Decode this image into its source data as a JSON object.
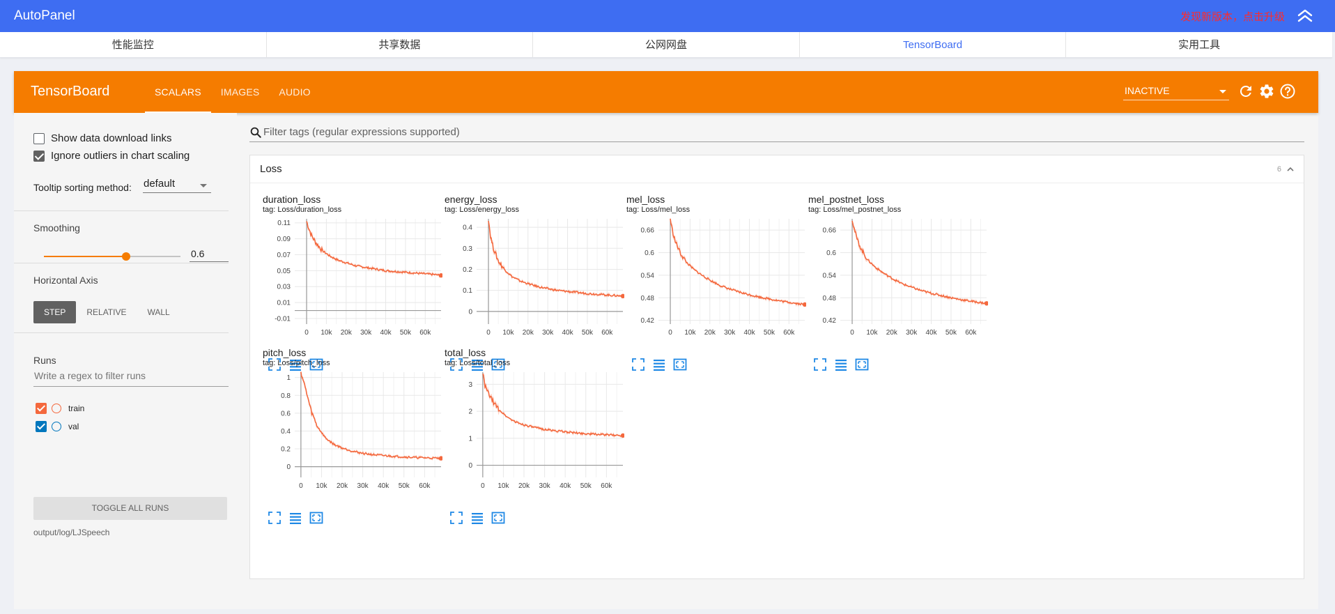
{
  "app": {
    "title": "AutoPanel",
    "upgrade_notice": "发现新版本，点击升级",
    "collapse_icon": "double-chevron-up-icon"
  },
  "tabs": [
    {
      "label": "性能监控",
      "active": false
    },
    {
      "label": "共享数据",
      "active": false
    },
    {
      "label": "公网网盘",
      "active": false
    },
    {
      "label": "TensorBoard",
      "active": true
    },
    {
      "label": "实用工具",
      "active": false
    }
  ],
  "tensorboard": {
    "brand": "TensorBoard",
    "nav": [
      {
        "label": "SCALARS",
        "active": true
      },
      {
        "label": "IMAGES",
        "active": false
      },
      {
        "label": "AUDIO",
        "active": false
      }
    ],
    "status_select": "INACTIVE",
    "icons": [
      "refresh-icon",
      "settings-icon",
      "help-icon"
    ],
    "accent_color": "#f57c00"
  },
  "sidebar": {
    "show_download_label": "Show data download links",
    "show_download_checked": false,
    "ignore_outliers_label": "Ignore outliers in chart scaling",
    "ignore_outliers_checked": true,
    "tooltip_sort_label": "Tooltip sorting method:",
    "tooltip_sort_value": "default",
    "smoothing_label": "Smoothing",
    "smoothing_value": "0.6",
    "smoothing_fraction": 0.6,
    "horizontal_axis_label": "Horizontal Axis",
    "axis_options": [
      {
        "label": "STEP",
        "active": true
      },
      {
        "label": "RELATIVE",
        "active": false
      },
      {
        "label": "WALL",
        "active": false
      }
    ],
    "runs_label": "Runs",
    "runs_filter_placeholder": "Write a regex to filter runs",
    "runs": [
      {
        "name": "train",
        "color": "#f4683d",
        "checked": true
      },
      {
        "name": "val",
        "color": "#0277bd",
        "checked": true
      }
    ],
    "toggle_all_label": "TOGGLE ALL RUNS",
    "log_dir": "output/log/LJSpeech"
  },
  "main": {
    "filter_placeholder": "Filter tags (regular expressions supported)",
    "card_title": "Loss",
    "card_count": "6"
  },
  "chart_data": [
    {
      "type": "line",
      "title": "duration_loss",
      "tag": "tag: Loss/duration_loss",
      "xticks": [
        "0",
        "10k",
        "20k",
        "30k",
        "40k",
        "50k",
        "60k"
      ],
      "yticks": [
        "0.11",
        "0.09",
        "0.07",
        "0.05",
        "0.03",
        "0.01",
        "-0.01"
      ],
      "ylim": [
        -0.017,
        0.115
      ],
      "xlim": [
        -6000,
        68000
      ],
      "series": [
        {
          "color": "#f4683d",
          "x": [
            0,
            1000,
            2500,
            5000,
            8000,
            12000,
            16000,
            20000,
            25000,
            30000,
            35000,
            40000,
            45000,
            50000,
            55000,
            60000,
            65000,
            68000
          ],
          "y": [
            0.112,
            0.104,
            0.094,
            0.084,
            0.075,
            0.068,
            0.063,
            0.06,
            0.056,
            0.054,
            0.052,
            0.05,
            0.049,
            0.048,
            0.047,
            0.046,
            0.045,
            0.044
          ]
        }
      ]
    },
    {
      "type": "line",
      "title": "energy_loss",
      "tag": "tag: Loss/energy_loss",
      "xticks": [
        "0",
        "10k",
        "20k",
        "30k",
        "40k",
        "50k",
        "60k"
      ],
      "yticks": [
        "0.4",
        "0.3",
        "0.2",
        "0.1",
        "0"
      ],
      "ylim": [
        -0.06,
        0.44
      ],
      "xlim": [
        -6000,
        68000
      ],
      "series": [
        {
          "color": "#f4683d",
          "x": [
            0,
            1000,
            2500,
            5000,
            8000,
            12000,
            16000,
            20000,
            25000,
            30000,
            35000,
            40000,
            45000,
            50000,
            55000,
            60000,
            65000,
            68000
          ],
          "y": [
            0.44,
            0.36,
            0.3,
            0.24,
            0.2,
            0.165,
            0.145,
            0.132,
            0.118,
            0.108,
            0.1,
            0.095,
            0.09,
            0.085,
            0.082,
            0.078,
            0.075,
            0.073
          ]
        }
      ]
    },
    {
      "type": "line",
      "title": "mel_loss",
      "tag": "tag: Loss/mel_loss",
      "xticks": [
        "0",
        "10k",
        "20k",
        "30k",
        "40k",
        "50k",
        "60k"
      ],
      "yticks": [
        "0.66",
        "0.6",
        "0.54",
        "0.48",
        "0.42"
      ],
      "ylim": [
        0.41,
        0.69
      ],
      "xlim": [
        -6000,
        68000
      ],
      "series": [
        {
          "color": "#f4683d",
          "x": [
            0,
            1000,
            2500,
            5000,
            8000,
            12000,
            16000,
            20000,
            25000,
            30000,
            35000,
            40000,
            45000,
            50000,
            55000,
            60000,
            65000,
            68000
          ],
          "y": [
            0.69,
            0.66,
            0.63,
            0.6,
            0.575,
            0.555,
            0.54,
            0.527,
            0.513,
            0.503,
            0.495,
            0.488,
            0.482,
            0.477,
            0.472,
            0.468,
            0.464,
            0.462
          ]
        }
      ]
    },
    {
      "type": "line",
      "title": "mel_postnet_loss",
      "tag": "tag: Loss/mel_postnet_loss",
      "xticks": [
        "0",
        "10k",
        "20k",
        "30k",
        "40k",
        "50k",
        "60k"
      ],
      "yticks": [
        "0.66",
        "0.6",
        "0.54",
        "0.48",
        "0.42"
      ],
      "ylim": [
        0.41,
        0.69
      ],
      "xlim": [
        -6000,
        68000
      ],
      "series": [
        {
          "color": "#f4683d",
          "x": [
            0,
            1000,
            2500,
            5000,
            8000,
            12000,
            16000,
            20000,
            25000,
            30000,
            35000,
            40000,
            45000,
            50000,
            55000,
            60000,
            65000,
            68000
          ],
          "y": [
            0.69,
            0.665,
            0.635,
            0.605,
            0.58,
            0.56,
            0.545,
            0.532,
            0.518,
            0.508,
            0.499,
            0.492,
            0.486,
            0.48,
            0.475,
            0.471,
            0.467,
            0.465
          ]
        }
      ]
    },
    {
      "type": "line",
      "title": "pitch_loss",
      "tag": "tag: Loss/pitch_loss",
      "xticks": [
        "0",
        "10k",
        "20k",
        "30k",
        "40k",
        "50k",
        "60k"
      ],
      "yticks": [
        "1",
        "0.8",
        "0.6",
        "0.4",
        "0.2",
        "0"
      ],
      "ylim": [
        -0.12,
        1.06
      ],
      "xlim": [
        -3000,
        68000
      ],
      "series": [
        {
          "color": "#f4683d",
          "x": [
            0,
            1000,
            2500,
            5000,
            8000,
            12000,
            16000,
            20000,
            25000,
            30000,
            35000,
            40000,
            45000,
            50000,
            55000,
            60000,
            65000,
            68000
          ],
          "y": [
            1.06,
            0.98,
            0.85,
            0.62,
            0.45,
            0.32,
            0.25,
            0.21,
            0.175,
            0.15,
            0.135,
            0.125,
            0.117,
            0.11,
            0.104,
            0.1,
            0.096,
            0.094
          ]
        }
      ]
    },
    {
      "type": "line",
      "title": "total_loss",
      "tag": "tag: Loss/total_loss",
      "xticks": [
        "0",
        "10k",
        "20k",
        "30k",
        "40k",
        "50k",
        "60k"
      ],
      "yticks": [
        "3",
        "2",
        "1",
        "0"
      ],
      "ylim": [
        -0.45,
        3.45
      ],
      "xlim": [
        -3000,
        68000
      ],
      "series": [
        {
          "color": "#f4683d",
          "x": [
            0,
            1000,
            2500,
            5000,
            8000,
            12000,
            16000,
            20000,
            25000,
            30000,
            35000,
            40000,
            45000,
            50000,
            55000,
            60000,
            65000,
            68000
          ],
          "y": [
            3.45,
            2.95,
            2.7,
            2.35,
            2.05,
            1.78,
            1.6,
            1.5,
            1.4,
            1.33,
            1.28,
            1.24,
            1.2,
            1.17,
            1.15,
            1.13,
            1.11,
            1.1
          ]
        }
      ]
    }
  ],
  "chart_tool_icons": [
    "fullscreen-icon",
    "toggle-log-icon",
    "fit-domain-icon"
  ]
}
